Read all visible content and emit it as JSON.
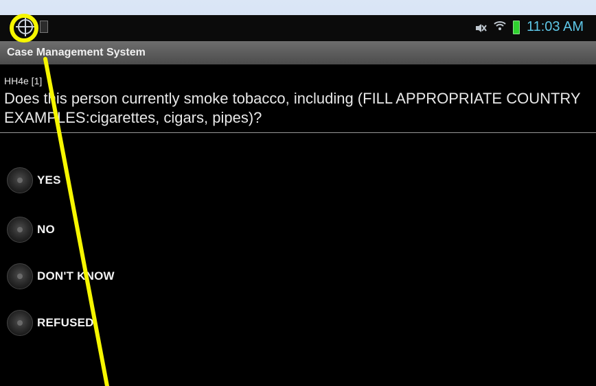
{
  "status_bar": {
    "time": "11:03 AM",
    "icons": [
      "crosshair-icon",
      "phone-icon",
      "mute-icon",
      "wifi-icon",
      "battery-icon"
    ]
  },
  "app": {
    "title": "Case Management System"
  },
  "question": {
    "id": "HH4e [1]",
    "text": "Does this person currently smoke tobacco, including (FILL APPROPRIATE COUNTRY EXAMPLES:cigarettes, cigars, pipes)?"
  },
  "options": [
    {
      "label": "YES"
    },
    {
      "label": "NO"
    },
    {
      "label": "DON'T KNOW"
    },
    {
      "label": "REFUSED"
    }
  ],
  "colors": {
    "annotation": "#f6f600",
    "background": "#000000"
  }
}
